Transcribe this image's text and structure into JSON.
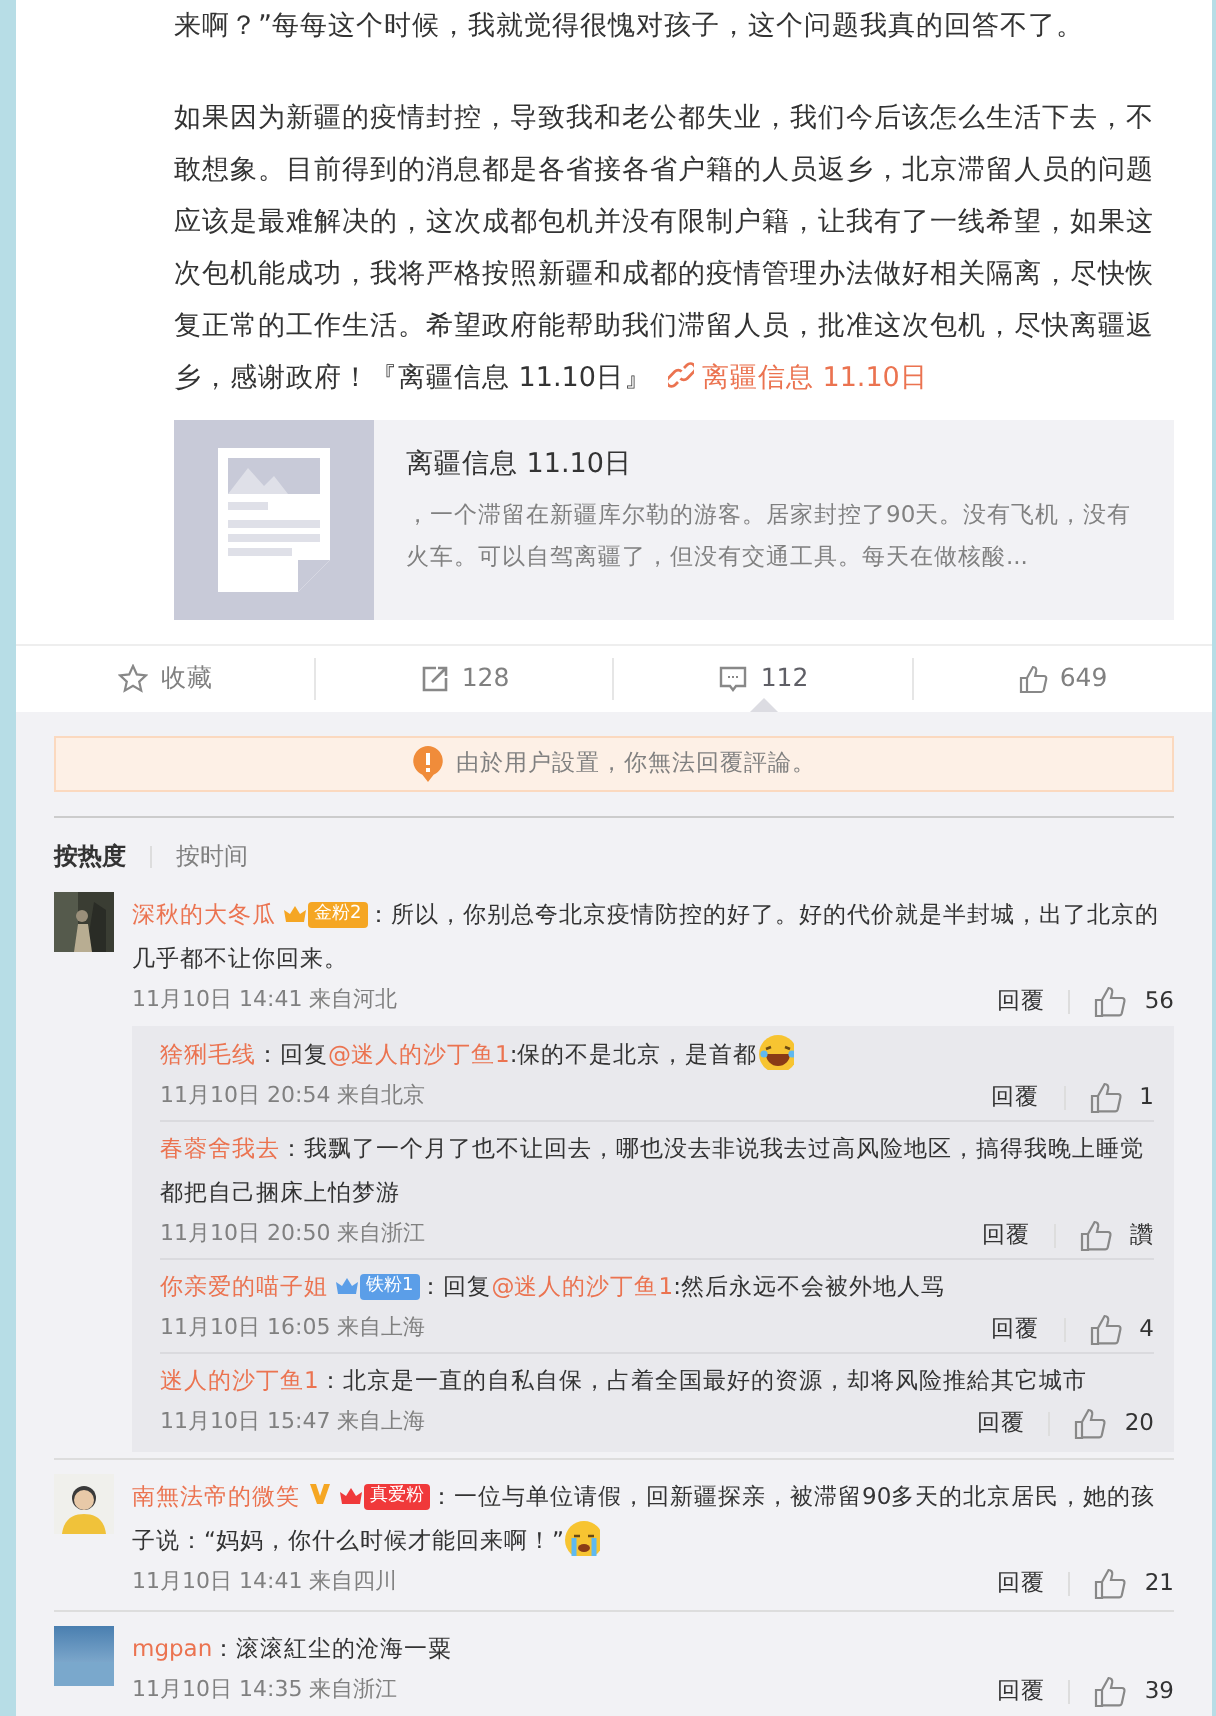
{
  "post": {
    "paragraphs": [
      "来啊？”每每这个时候，我就觉得很愧对孩子，这个问题我真的回答不了。",
      "如果因为新疆的疫情封控，导致我和老公都失业，我们今后该怎么生活下去，不敢想象。目前得到的消息都是各省接各省户籍的人员返乡，北京滞留人员的问题应该是最难解决的，这次成都包机并没有限制户籍，让我有了一线希望，如果这次包机能成功，我将严格按照新疆和成都的疫情管理办法做好相关隔离，尽快恢复正常的工作生活。希望政府能帮助我们滞留人员，批准这次包机，尽快离疆返乡，感谢政府！『离疆信息 11.10日』"
    ],
    "link": "离疆信息 11.10日",
    "card": {
      "title": "离疆信息 11.10日",
      "summary": "，一个滞留在新疆库尔勒的游客。居家封控了90天。没有飞机，没有火车。可以自驾离疆了，但没有交通工具。每天在做核酸..."
    }
  },
  "actions": [
    {
      "kind": "favorite",
      "label": "收藏",
      "selected": false
    },
    {
      "kind": "share",
      "label": "128",
      "selected": false
    },
    {
      "kind": "comment",
      "label": "112",
      "selected": true
    },
    {
      "kind": "like",
      "label": "649",
      "selected": false
    }
  ],
  "notice": "由於用户設置，你無法回覆評論。",
  "sort_tabs": [
    {
      "label": "按热度",
      "selected": true
    },
    {
      "label": "按时间",
      "selected": false
    }
  ],
  "comments": [
    {
      "user": "深秋的大冬瓜",
      "verified": false,
      "badge": {
        "text": "金粉2",
        "color": "#f5a623"
      },
      "text": "：所以，你别总夸北京疫情防控的好了。好的代价就是半封城，出了北京的几乎都不让你回来。",
      "time": "11月10日 14:41 来自河北",
      "reply": "回覆",
      "likes": "56",
      "replies": [
        {
          "user": "猞猁毛线",
          "prefix": "：回复",
          "mention": "@迷人的沙丁鱼1",
          "text": ":保的不是北京，是首都",
          "emoji": {
            "kind": "laugh"
          },
          "time": "11月10日 20:54 来自北京",
          "reply": "回覆",
          "likes": "1"
        },
        {
          "user": "春蓉舍我去",
          "text": "：我飘了一个月了也不让回去，哪也没去非说我去过高风险地区，搞得我晚上睡觉都把自己捆床上怕梦游",
          "time": "11月10日 20:50 来自浙江",
          "reply": "回覆",
          "likes": "讚"
        },
        {
          "user": "你亲爱的喵子姐",
          "badge": {
            "text": "铁粉1",
            "color": "#5b9ee8"
          },
          "prefix": "：回复",
          "mention": "@迷人的沙丁鱼1",
          "text": ":然后永远不会被外地人骂",
          "time": "11月10日 16:05 来自上海",
          "reply": "回覆",
          "likes": "4"
        },
        {
          "user": "迷人的沙丁鱼1",
          "text": "：北京是一直的自私自保，占着全国最好的资源，却将风险推給其它城市",
          "time": "11月10日 15:47 来自上海",
          "reply": "回覆",
          "likes": "20"
        }
      ]
    },
    {
      "user": "南無法帝的微笑",
      "verified": true,
      "badge": {
        "text": "真爱粉",
        "color": "#f0393a"
      },
      "text": "：一位与单位请假，回新疆探亲，被滞留90多天的北京居民，她的孩子说：“妈妈，你什么时候才能回来啊！”",
      "emoji": {
        "kind": "cry"
      },
      "time": "11月10日 14:41 来自四川",
      "reply": "回覆",
      "likes": "21"
    },
    {
      "user": "mgpan",
      "verified": false,
      "text": "：滚滚紅尘的沧海一粟",
      "time": "11月10日 14:35 来自浙江",
      "reply": "回覆",
      "likes": "39"
    }
  ]
}
